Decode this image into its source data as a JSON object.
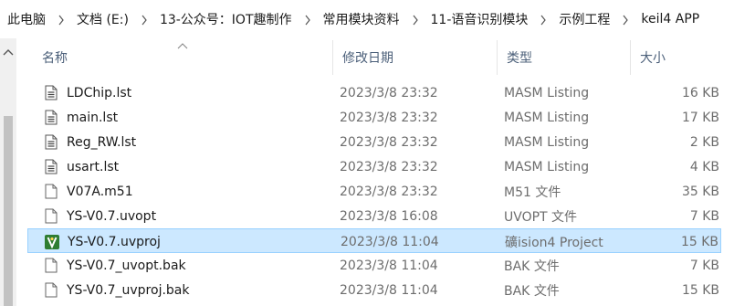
{
  "breadcrumb": [
    "此电脑",
    "文档 (E:)",
    "13-公众号：IOT趣制作",
    "常用模块资料",
    "11-语音识别模块",
    "示例工程",
    "keil4 APP"
  ],
  "columns": {
    "name": "名称",
    "date": "修改日期",
    "type": "类型",
    "size": "大小"
  },
  "files": [
    {
      "name": "LDChip.lst",
      "date": "2023/3/8 23:32",
      "type": "MASM Listing",
      "size": "16 KB",
      "icon": "text-doc-icon"
    },
    {
      "name": "main.lst",
      "date": "2023/3/8 23:32",
      "type": "MASM Listing",
      "size": "17 KB",
      "icon": "text-doc-icon"
    },
    {
      "name": "Reg_RW.lst",
      "date": "2023/3/8 23:32",
      "type": "MASM Listing",
      "size": "2 KB",
      "icon": "text-doc-icon"
    },
    {
      "name": "usart.lst",
      "date": "2023/3/8 23:32",
      "type": "MASM Listing",
      "size": "4 KB",
      "icon": "text-doc-icon"
    },
    {
      "name": "V07A.m51",
      "date": "2023/3/8 23:32",
      "type": "M51 文件",
      "size": "35 KB",
      "icon": "blank-doc-icon"
    },
    {
      "name": "YS-V0.7.uvopt",
      "date": "2023/3/8 16:08",
      "type": "UVOPT 文件",
      "size": "7 KB",
      "icon": "blank-doc-icon"
    },
    {
      "name": "YS-V0.7.uvproj",
      "date": "2023/3/8 11:04",
      "type": "礦ision4 Project",
      "size": "15 KB",
      "icon": "keil-project-icon",
      "selected": true
    },
    {
      "name": "YS-V0.7_uvopt.bak",
      "date": "2023/3/8 11:04",
      "type": "BAK 文件",
      "size": "7 KB",
      "icon": "blank-doc-icon"
    },
    {
      "name": "YS-V0.7_uvproj.bak",
      "date": "2023/3/8 11:04",
      "type": "BAK 文件",
      "size": "15 KB",
      "icon": "blank-doc-icon"
    }
  ],
  "colors": {
    "selection_bg": "#cce8ff",
    "selection_border": "#99d1ff",
    "header_text": "#4c607a",
    "keil_green": "#2e7d32"
  }
}
